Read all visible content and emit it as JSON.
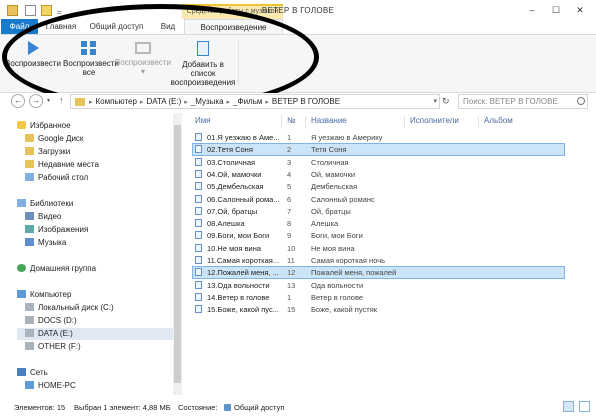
{
  "titlebar": {
    "ribbon_context": "Средства работы с музыкой",
    "window_title": "ВЕТЕР В ГОЛОВЕ",
    "minimize": "–",
    "maximize": "☐",
    "close": "✕"
  },
  "ribbon_tabs": {
    "file": "Файл",
    "home": "Главная",
    "share": "Общий доступ",
    "view": "Вид",
    "play": "Воспроизведение"
  },
  "ribbon": {
    "play_label": "Воспроизвести",
    "play_all_line1": "Воспроизвести",
    "play_all_line2": "все",
    "play_to_label": "Воспроизвести",
    "play_to_arrow": "▾",
    "add_list_line1": "Добавить в список",
    "add_list_line2": "воспроизведения"
  },
  "address": {
    "path": [
      "Компьютер",
      "DATA (E:)",
      "_Музыка",
      "_Фильм",
      "ВЕТЕР В ГОЛОВЕ"
    ],
    "separator": "▸",
    "search_placeholder": "Поиск: ВЕТЕР В ГОЛОВЕ"
  },
  "nav_pane": {
    "favorites": "Избранное",
    "google_drive": "Google Диск",
    "downloads": "Загрузки",
    "recent": "Недавние места",
    "desktop": "Рабочий стол",
    "libraries": "Библиотеки",
    "video": "Видео",
    "pictures": "Изображения",
    "music": "Музыка",
    "homegroup": "Домашняя группа",
    "computer": "Компьютер",
    "local_c": "Локальный диск (C:)",
    "docs_d": "DOCS (D:)",
    "data_e": "DATA (E:)",
    "other_f": "OTHER (F:)",
    "network": "Сеть",
    "home_pc": "HOME-PC"
  },
  "columns": {
    "name": "Имя",
    "number": "№",
    "title": "Название",
    "artist": "Исполнители",
    "album": "Альбом"
  },
  "files": [
    {
      "name": "01.Я уезжаю в Аме...",
      "num": "1",
      "title": "Я уезжаю в Америку"
    },
    {
      "name": "02.Тетя Соня",
      "num": "2",
      "title": "Тетя Соня"
    },
    {
      "name": "03.Столичная",
      "num": "3",
      "title": "Столичная"
    },
    {
      "name": "04.Ой, мамочки",
      "num": "4",
      "title": "Ой, мамочки"
    },
    {
      "name": "05.Дембельская",
      "num": "5",
      "title": "Дембельская"
    },
    {
      "name": "06.Салонный рома...",
      "num": "6",
      "title": "Салонный романс"
    },
    {
      "name": "07.Ой, братцы",
      "num": "7",
      "title": "Ой, братцы"
    },
    {
      "name": "08.Алешка",
      "num": "8",
      "title": "Алешка"
    },
    {
      "name": "09.Боги, мои Боги",
      "num": "9",
      "title": "Боги, мои Боги"
    },
    {
      "name": "10.Не моя вина",
      "num": "10",
      "title": "Не моя вина"
    },
    {
      "name": "11.Самая короткая...",
      "num": "11",
      "title": "Самая короткая ночь"
    },
    {
      "name": "12.Пожалей меня, ...",
      "num": "12",
      "title": "Пожалей меня, пожалей"
    },
    {
      "name": "13.Ода вольности",
      "num": "13",
      "title": "Ода вольности"
    },
    {
      "name": "14.Ветер в голове",
      "num": "1",
      "title": "Ветер в голове"
    },
    {
      "name": "15.Боже, какой пус...",
      "num": "15",
      "title": "Боже, какой пустяк"
    }
  ],
  "status": {
    "count": "Элементов: 15",
    "selection": "Выбран 1 элемент: 4,88 МБ",
    "state_label": "Состояние:",
    "shared": "Общий доступ"
  }
}
